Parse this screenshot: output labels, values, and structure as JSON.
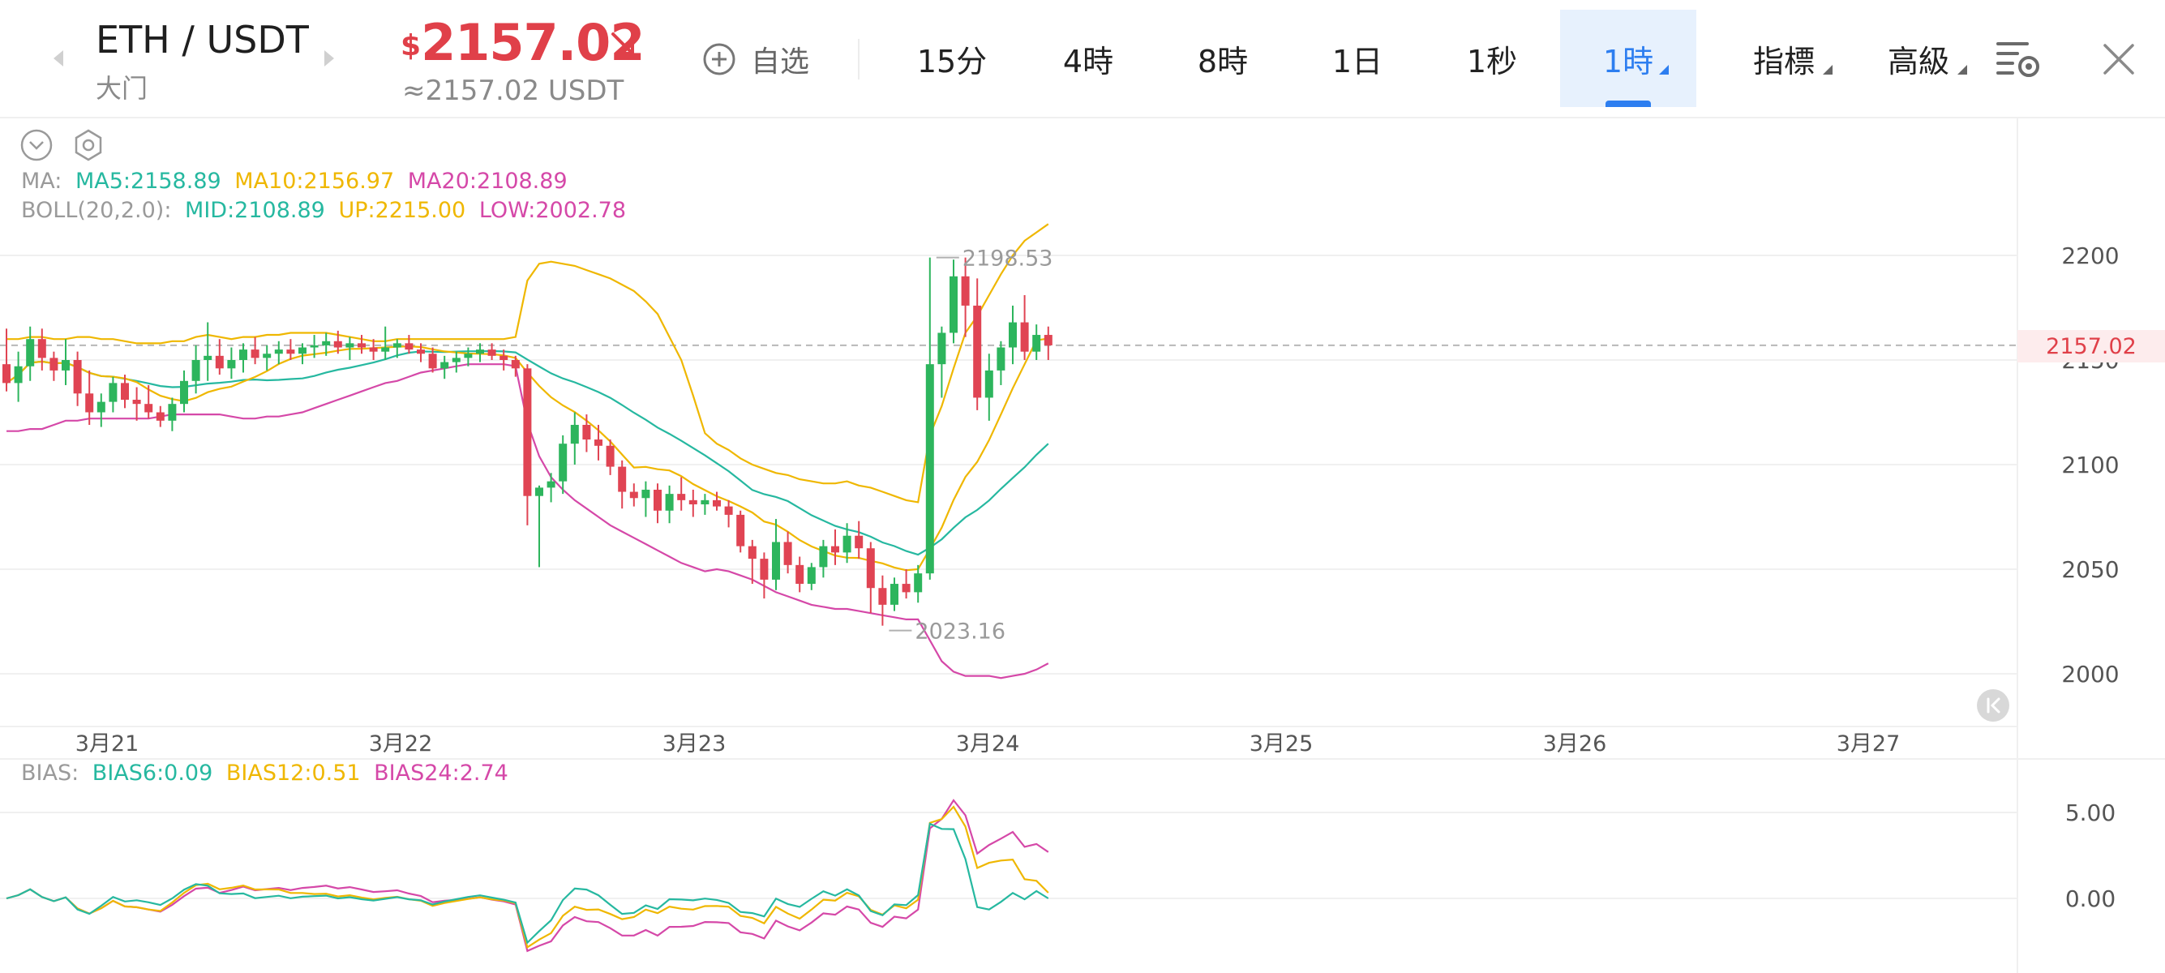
{
  "header": {
    "pair": "ETH / USDT",
    "exchange": "大门",
    "price_currency": "$",
    "price": "2157.02",
    "price_approx": "≈2157.02 USDT",
    "price_direction": "down",
    "favorite_label": "自选",
    "tabs": [
      {
        "label": "15分",
        "active": false,
        "dropdown": false
      },
      {
        "label": "4時",
        "active": false,
        "dropdown": false
      },
      {
        "label": "8時",
        "active": false,
        "dropdown": false
      },
      {
        "label": "1日",
        "active": false,
        "dropdown": false
      },
      {
        "label": "1秒",
        "active": false,
        "dropdown": false
      },
      {
        "label": "1時",
        "active": true,
        "dropdown": true
      },
      {
        "label": "指標",
        "active": false,
        "dropdown": true
      },
      {
        "label": "高級",
        "active": false,
        "dropdown": true
      }
    ],
    "icons": {
      "prev": "chevron-left-icon",
      "next": "chevron-right-icon",
      "fav": "plus-circle-icon",
      "settings": "chart-settings-icon",
      "close": "close-icon"
    }
  },
  "legend": {
    "ma": {
      "label": "MA:",
      "items": [
        {
          "text": "MA5:2158.89",
          "color": "#26b8a0"
        },
        {
          "text": "MA10:2156.97",
          "color": "#efb700"
        },
        {
          "text": "MA20:2108.89",
          "color": "#d548a8"
        }
      ]
    },
    "boll": {
      "label": "BOLL(20,2.0):",
      "items": [
        {
          "text": "MID:2108.89",
          "color": "#26b8a0"
        },
        {
          "text": "UP:2215.00",
          "color": "#efb700"
        },
        {
          "text": "LOW:2002.78",
          "color": "#d548a8"
        }
      ]
    },
    "bias": {
      "label": "BIAS:",
      "items": [
        {
          "text": "BIAS6:0.09",
          "color": "#26b8a0"
        },
        {
          "text": "BIAS12:0.51",
          "color": "#efb700"
        },
        {
          "text": "BIAS24:2.74",
          "color": "#d548a8"
        }
      ]
    }
  },
  "colors": {
    "up": "#2db55d",
    "down": "#e04453",
    "mid": "#26b8a0",
    "upper": "#efb700",
    "lower": "#d548a8",
    "grid": "#f0f0f0",
    "axis_text": "#555555"
  },
  "current_price_tag": "2157.02",
  "chart_data": {
    "type": "candlestick",
    "interval": "1時",
    "x_labels": [
      "3月21",
      "3月22",
      "3月23",
      "3月24",
      "3月25",
      "3月26",
      "3月27"
    ],
    "y_ticks": [
      2200,
      2150,
      2100,
      2050,
      2000
    ],
    "y_range": [
      1975,
      2233
    ],
    "annotations": [
      {
        "text": "2198.53",
        "type": "high"
      },
      {
        "text": "2023.16",
        "type": "low"
      }
    ],
    "current_price": 2157.02,
    "candles": [
      [
        2148,
        2165,
        2135,
        2139
      ],
      [
        2139,
        2154,
        2130,
        2147
      ],
      [
        2147,
        2166,
        2140,
        2160
      ],
      [
        2160,
        2165,
        2145,
        2151
      ],
      [
        2151,
        2154,
        2140,
        2145
      ],
      [
        2145,
        2160,
        2138,
        2150
      ],
      [
        2150,
        2154,
        2128,
        2134
      ],
      [
        2134,
        2145,
        2119,
        2125
      ],
      [
        2125,
        2134,
        2118,
        2130
      ],
      [
        2130,
        2142,
        2125,
        2139
      ],
      [
        2139,
        2143,
        2127,
        2131
      ],
      [
        2131,
        2137,
        2121,
        2129
      ],
      [
        2129,
        2138,
        2122,
        2125
      ],
      [
        2125,
        2128,
        2118,
        2121
      ],
      [
        2121,
        2132,
        2116,
        2129
      ],
      [
        2129,
        2145,
        2125,
        2140
      ],
      [
        2140,
        2157,
        2134,
        2150
      ],
      [
        2150,
        2168,
        2140,
        2152
      ],
      [
        2152,
        2160,
        2143,
        2146
      ],
      [
        2146,
        2156,
        2141,
        2150
      ],
      [
        2150,
        2158,
        2144,
        2155
      ],
      [
        2155,
        2161,
        2148,
        2151
      ],
      [
        2151,
        2157,
        2145,
        2153
      ],
      [
        2153,
        2159,
        2148,
        2155
      ],
      [
        2155,
        2160,
        2150,
        2153
      ],
      [
        2153,
        2158,
        2148,
        2156
      ],
      [
        2156,
        2162,
        2151,
        2157
      ],
      [
        2157,
        2163,
        2152,
        2159
      ],
      [
        2159,
        2164,
        2153,
        2156
      ],
      [
        2156,
        2161,
        2150,
        2158
      ],
      [
        2158,
        2162,
        2153,
        2156
      ],
      [
        2156,
        2160,
        2150,
        2154
      ],
      [
        2154,
        2166,
        2150,
        2156
      ],
      [
        2156,
        2160,
        2151,
        2158
      ],
      [
        2158,
        2162,
        2153,
        2155
      ],
      [
        2155,
        2158,
        2149,
        2153
      ],
      [
        2153,
        2156,
        2144,
        2146
      ],
      [
        2146,
        2152,
        2141,
        2149
      ],
      [
        2149,
        2154,
        2144,
        2151
      ],
      [
        2151,
        2156,
        2147,
        2153
      ],
      [
        2153,
        2158,
        2149,
        2155
      ],
      [
        2155,
        2158,
        2150,
        2152
      ],
      [
        2152,
        2155,
        2145,
        2150
      ],
      [
        2150,
        2152,
        2142,
        2146
      ],
      [
        2146,
        2148,
        2071,
        2085
      ],
      [
        2085,
        2090,
        2051,
        2089
      ],
      [
        2089,
        2096,
        2082,
        2092
      ],
      [
        2092,
        2114,
        2086,
        2110
      ],
      [
        2110,
        2125,
        2100,
        2119
      ],
      [
        2119,
        2124,
        2106,
        2112
      ],
      [
        2112,
        2119,
        2102,
        2109
      ],
      [
        2109,
        2112,
        2095,
        2099
      ],
      [
        2099,
        2102,
        2079,
        2087
      ],
      [
        2087,
        2091,
        2080,
        2084
      ],
      [
        2084,
        2092,
        2075,
        2088
      ],
      [
        2088,
        2091,
        2072,
        2078
      ],
      [
        2078,
        2090,
        2072,
        2086
      ],
      [
        2086,
        2094,
        2078,
        2083
      ],
      [
        2083,
        2088,
        2075,
        2081
      ],
      [
        2081,
        2086,
        2076,
        2083
      ],
      [
        2083,
        2087,
        2078,
        2080
      ],
      [
        2080,
        2083,
        2070,
        2076
      ],
      [
        2076,
        2078,
        2058,
        2061
      ],
      [
        2061,
        2064,
        2043,
        2055
      ],
      [
        2055,
        2058,
        2036,
        2045
      ],
      [
        2045,
        2074,
        2040,
        2063
      ],
      [
        2063,
        2068,
        2048,
        2052
      ],
      [
        2052,
        2056,
        2039,
        2043
      ],
      [
        2043,
        2053,
        2040,
        2051
      ],
      [
        2051,
        2064,
        2046,
        2061
      ],
      [
        2061,
        2069,
        2052,
        2058
      ],
      [
        2058,
        2072,
        2053,
        2066
      ],
      [
        2066,
        2073,
        2055,
        2060
      ],
      [
        2060,
        2063,
        2029,
        2041
      ],
      [
        2041,
        2047,
        2023,
        2033
      ],
      [
        2033,
        2046,
        2030,
        2043
      ],
      [
        2043,
        2050,
        2036,
        2039
      ],
      [
        2039,
        2052,
        2034,
        2048
      ],
      [
        2048,
        2199,
        2045,
        2148
      ],
      [
        2148,
        2166,
        2132,
        2163
      ],
      [
        2163,
        2198,
        2158,
        2190
      ],
      [
        2190,
        2199,
        2161,
        2176
      ],
      [
        2176,
        2189,
        2126,
        2132
      ],
      [
        2132,
        2153,
        2121,
        2145
      ],
      [
        2145,
        2159,
        2138,
        2156
      ],
      [
        2156,
        2176,
        2148,
        2168
      ],
      [
        2168,
        2181,
        2150,
        2154
      ],
      [
        2154,
        2167,
        2150,
        2162
      ],
      [
        2162,
        2166,
        2150,
        2157
      ]
    ],
    "series": [
      {
        "name": "MA5",
        "color": "#26b8a0"
      },
      {
        "name": "MA10",
        "color": "#efb700"
      },
      {
        "name": "MA20",
        "color": "#d548a8"
      },
      {
        "name": "BIAS6",
        "color": "#26b8a0"
      },
      {
        "name": "BIAS12",
        "color": "#efb700"
      },
      {
        "name": "BIAS24",
        "color": "#d548a8"
      }
    ],
    "boll_upper": [
      2160,
      2160,
      2161,
      2161,
      2160,
      2160,
      2161,
      2161,
      2160,
      2160,
      2159,
      2158,
      2158,
      2158,
      2159,
      2159,
      2161,
      2162,
      2161,
      2160,
      2161,
      2161,
      2162,
      2162,
      2163,
      2163,
      2163,
      2163,
      2162,
      2161,
      2160,
      2159,
      2159,
      2160,
      2160,
      2160,
      2160,
      2160,
      2160,
      2160,
      2160,
      2160,
      2160,
      2161,
      2188,
      2196,
      2197,
      2196,
      2195,
      2193,
      2191,
      2189,
      2186,
      2183,
      2178,
      2172,
      2161,
      2150,
      2133,
      2115,
      2110,
      2107,
      2103,
      2100,
      2098,
      2096,
      2095,
      2093,
      2092,
      2091,
      2091,
      2092,
      2090,
      2089,
      2087,
      2085,
      2083,
      2082,
      2114,
      2128,
      2146,
      2163,
      2171,
      2181,
      2191,
      2200,
      2207,
      2211,
      2215
    ],
    "boll_lower": [
      2116,
      2116,
      2117,
      2117,
      2119,
      2121,
      2121,
      2122,
      2122,
      2122,
      2122,
      2122,
      2122,
      2123,
      2124,
      2124,
      2124,
      2124,
      2124,
      2123,
      2122,
      2122,
      2123,
      2123,
      2124,
      2125,
      2127,
      2129,
      2131,
      2133,
      2135,
      2137,
      2139,
      2140,
      2142,
      2144,
      2145,
      2146,
      2147,
      2148,
      2148,
      2148,
      2148,
      2147,
      2120,
      2104,
      2094,
      2088,
      2083,
      2079,
      2075,
      2071,
      2068,
      2065,
      2062,
      2059,
      2056,
      2053,
      2051,
      2049,
      2050,
      2049,
      2047,
      2045,
      2042,
      2039,
      2037,
      2035,
      2033,
      2032,
      2031,
      2031,
      2030,
      2029,
      2028,
      2027,
      2026,
      2026,
      2016,
      2006,
      2001,
      1999,
      1999,
      1999,
      1998,
      1999,
      2000,
      2002,
      2005
    ]
  }
}
